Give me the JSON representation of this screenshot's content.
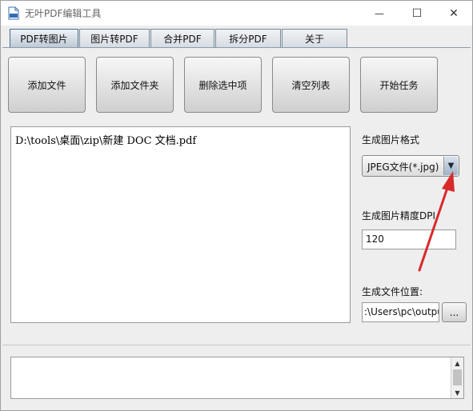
{
  "window": {
    "title": "无叶PDF编辑工具",
    "controls": {
      "minimize": "—",
      "maximize": "☐",
      "close": "✕"
    }
  },
  "tabs": [
    {
      "label": "PDF转图片",
      "active": true
    },
    {
      "label": "图片转PDF",
      "active": false
    },
    {
      "label": "合并PDF",
      "active": false
    },
    {
      "label": "拆分PDF",
      "active": false
    },
    {
      "label": "关于",
      "active": false
    }
  ],
  "actions": [
    {
      "label": "添加文件"
    },
    {
      "label": "添加文件夹"
    },
    {
      "label": "删除选中项"
    },
    {
      "label": "清空列表"
    },
    {
      "label": "开始任务"
    }
  ],
  "file_list": {
    "items": [
      "D:\\tools\\桌面\\zip\\新建 DOC 文档.pdf"
    ]
  },
  "settings": {
    "format_label": "生成图片格式",
    "format_value": "JPEG文件(*.jpg)",
    "format_arrow": "▼",
    "dpi_label": "生成图片精度DPI",
    "dpi_value": "120",
    "output_label": "生成文件位置:",
    "output_value": ":\\Users\\pc\\output",
    "browse_label": "..."
  },
  "log": {
    "scroll_up": "▲",
    "scroll_down": "▼"
  },
  "colors": {
    "annotation_arrow": "#d9292b"
  }
}
